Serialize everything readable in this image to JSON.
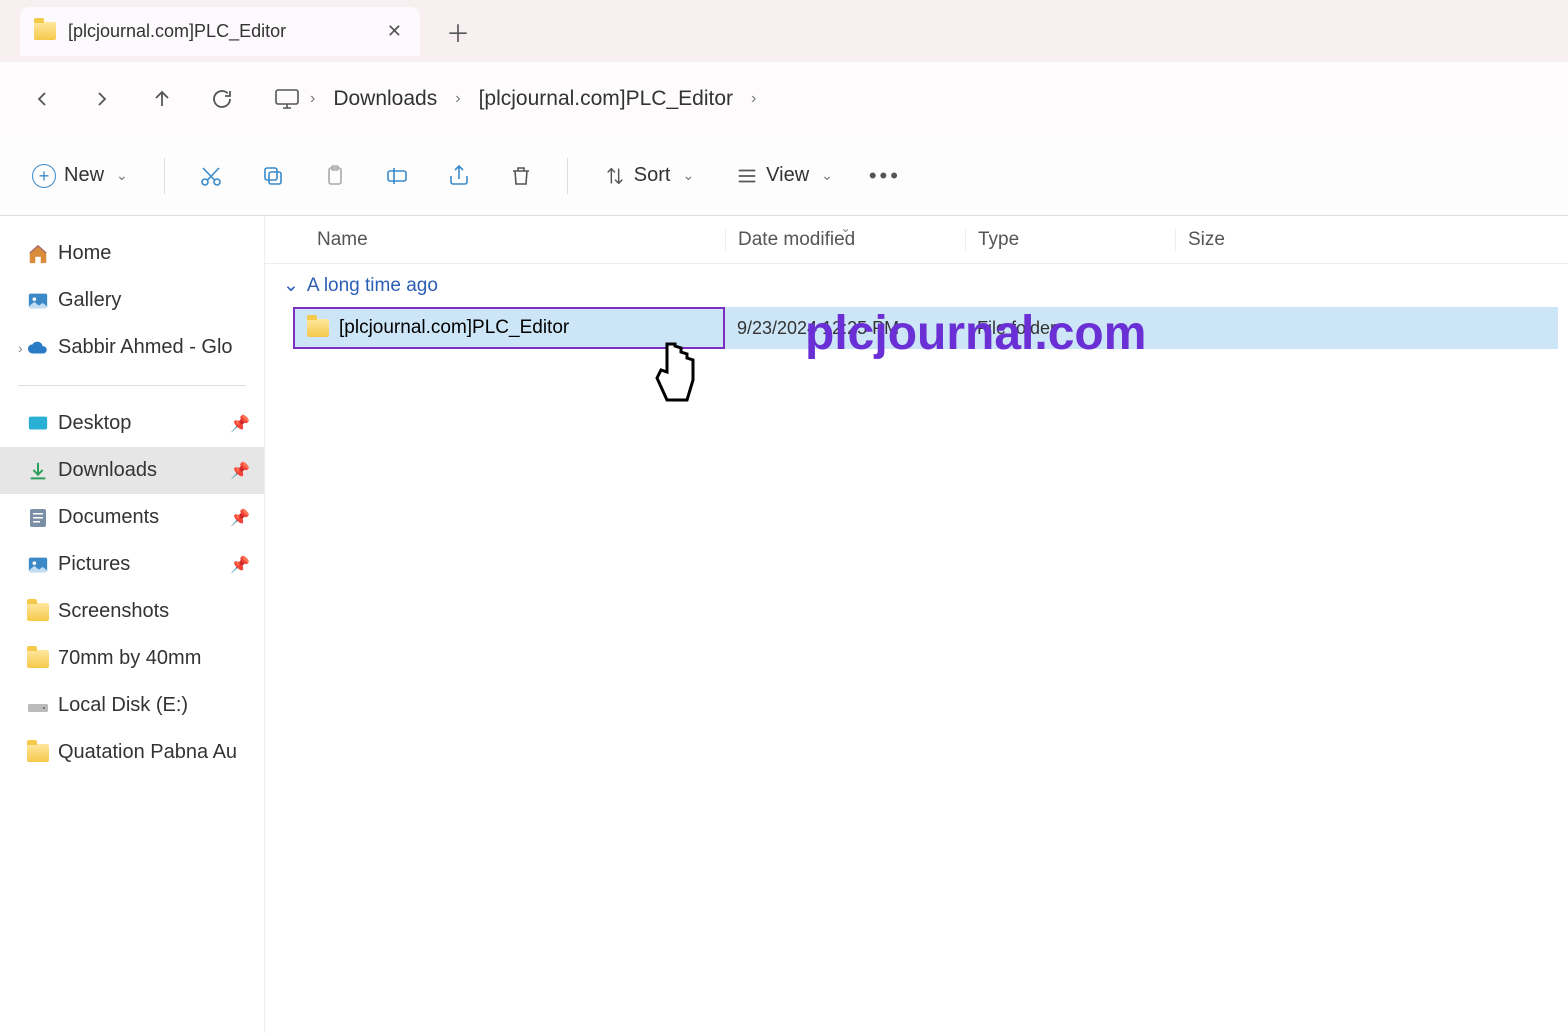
{
  "tab": {
    "title": "[plcjournal.com]PLC_Editor"
  },
  "breadcrumb": {
    "seg1": "Downloads",
    "seg2": "[plcjournal.com]PLC_Editor"
  },
  "toolbar": {
    "new": "New",
    "sort": "Sort",
    "view": "View"
  },
  "sidebar": {
    "home": "Home",
    "gallery": "Gallery",
    "onedrive": "Sabbir Ahmed - Glo",
    "desktop": "Desktop",
    "downloads": "Downloads",
    "documents": "Documents",
    "pictures": "Pictures",
    "screenshots": "Screenshots",
    "f70mm": "70mm by 40mm",
    "localdisk": "Local Disk (E:)",
    "quatation": "Quatation Pabna Au"
  },
  "columns": {
    "name": "Name",
    "date": "Date modified",
    "type": "Type",
    "size": "Size"
  },
  "group": {
    "header": "A long time ago"
  },
  "row": {
    "name": "[plcjournal.com]PLC_Editor",
    "date": "9/23/2024 12:25 PM",
    "type": "File folder"
  },
  "watermark": "plcjournal.com"
}
